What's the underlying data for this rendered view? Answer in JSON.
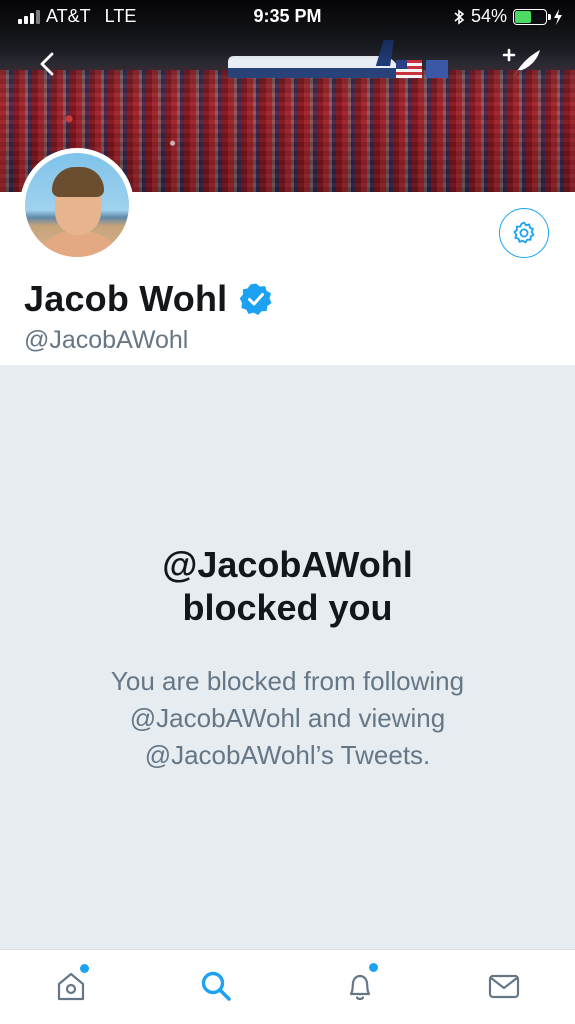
{
  "status_bar": {
    "carrier": "AT&T",
    "network": "LTE",
    "time": "9:35 PM",
    "battery_percent": "54%",
    "battery_level": 0.54
  },
  "header": {
    "back_icon": "chevron-left-icon",
    "compose_icon": "compose-tweet-icon"
  },
  "profile": {
    "display_name": "Jacob Wohl",
    "handle": "@JacobAWohl",
    "verified": true,
    "settings_icon": "gear-icon"
  },
  "blocked": {
    "title_line1": "@JacobAWohl",
    "title_line2": "blocked you",
    "description": "You are blocked from following @JacobAWohl and viewing @JacobAWohl’s Tweets."
  },
  "tabbar": {
    "tabs": [
      {
        "icon": "home-icon",
        "has_dot": true
      },
      {
        "icon": "search-icon",
        "active": true
      },
      {
        "icon": "notifications-icon",
        "has_dot": true
      },
      {
        "icon": "messages-icon"
      }
    ]
  },
  "colors": {
    "accent": "#1da1f2",
    "gray_text": "#657786",
    "background_blocked": "#e6ecf0"
  }
}
